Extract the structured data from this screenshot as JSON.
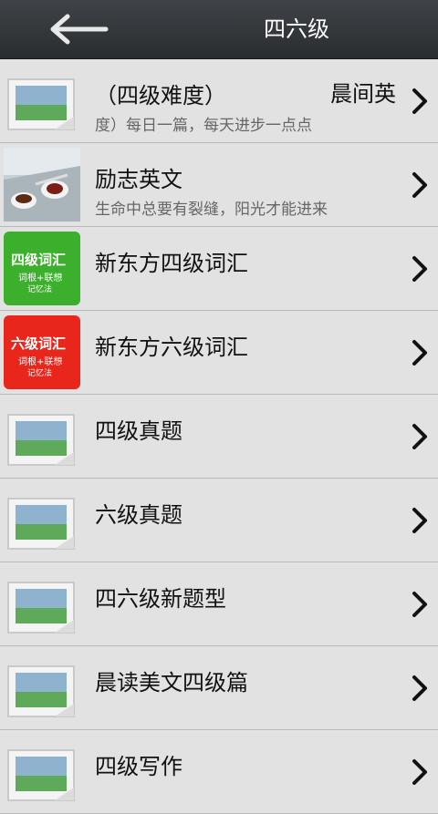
{
  "header": {
    "title": "四六级",
    "back_icon": "back-arrow-icon"
  },
  "list": [
    {
      "title_a": "（四级难度）",
      "title_b": "晨间英",
      "subtitle": "度）每日一篇，每天进步一点点",
      "thumb": "placeholder"
    },
    {
      "title": "励志英文",
      "subtitle": "生命中总要有裂缝，阳光才能进来",
      "thumb": "coffee"
    },
    {
      "title": "新东方四级词汇",
      "thumb": "green-book",
      "book_main": "四级词汇",
      "book_sub": "词根+联想",
      "book_sub2": "记忆法"
    },
    {
      "title": "新东方六级词汇",
      "thumb": "red-book",
      "book_main": "六级词汇",
      "book_sub": "词根+联想",
      "book_sub2": "记忆法"
    },
    {
      "title": "四级真题",
      "thumb": "placeholder"
    },
    {
      "title": "六级真题",
      "thumb": "placeholder"
    },
    {
      "title": "四六级新题型",
      "thumb": "placeholder"
    },
    {
      "title": "晨读美文四级篇",
      "thumb": "placeholder"
    },
    {
      "title": "四级写作",
      "thumb": "placeholder"
    }
  ]
}
